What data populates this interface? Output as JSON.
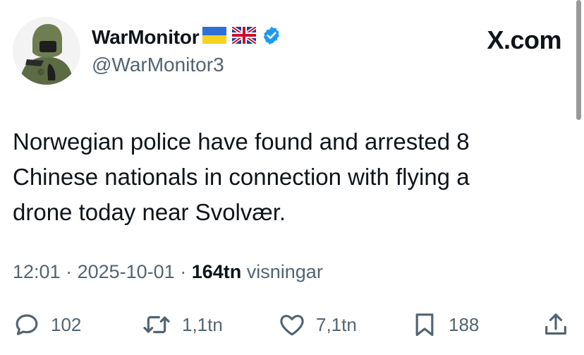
{
  "author": {
    "name": "WarMonitor",
    "handle": "@WarMonitor3",
    "verified": true,
    "flags": [
      "ukraine-flag",
      "uk-flag"
    ]
  },
  "brand": "X.com",
  "tweet": {
    "text": "Norwegian police have found and arrested 8\nChinese nationals in connection with flying a\ndrone today near Svolvær.",
    "time": "12:01",
    "sep1": " · ",
    "date": "2025-10-01",
    "sep2": " · ",
    "views_count": "164tn",
    "views_label": " visningar"
  },
  "actions": {
    "replies": "102",
    "reposts": "1,1tn",
    "likes": "7,1tn",
    "bookmarks": "188"
  },
  "colors": {
    "text": "#0f1419",
    "secondary": "#536471",
    "verified": "#1d9bf0"
  }
}
